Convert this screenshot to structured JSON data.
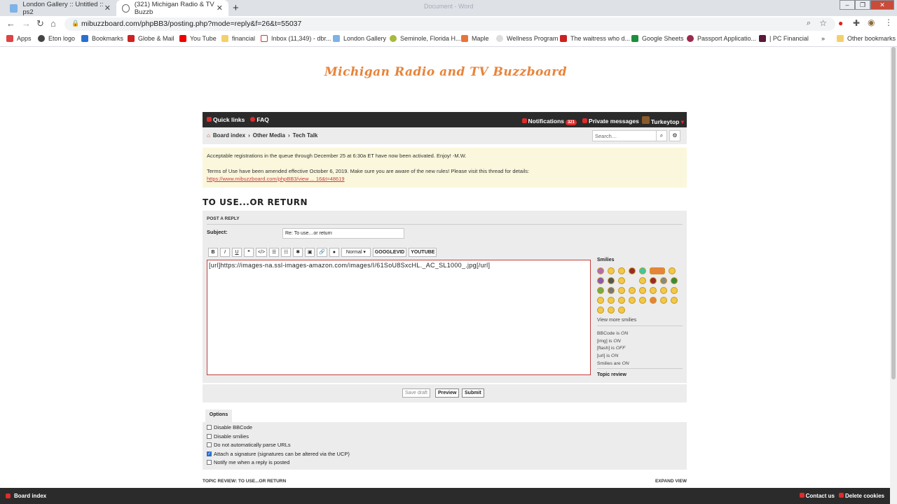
{
  "browser": {
    "tabs": [
      {
        "title": "London Gallery :: Untitled :: ps2"
      },
      {
        "title": "(321) Michigan Radio & TV Buzzb"
      }
    ],
    "window_title": "Document - Word",
    "url": "mibuzzboard.com/phpBB3/posting.php?mode=reply&f=26&t=55037",
    "bookmarks": [
      "Apps",
      "Eton logo",
      "Bookmarks",
      "Globe & Mail",
      "You Tube",
      "financial",
      "Inbox (11,349) - dbr...",
      "London Gallery",
      "Seminole, Florida H...",
      "Maple",
      "Wellness Program",
      "The waitress who d...",
      "Google Sheets",
      "Passport Applicatio...",
      "| PC Financial",
      "»",
      "Other bookmarks"
    ]
  },
  "site": {
    "logo": "Michigan Radio and TV Buzzboard",
    "nav": {
      "quick_links": "Quick links",
      "faq": "FAQ",
      "notifications": "Notifications",
      "notifications_count": "321",
      "private_messages": "Private messages",
      "username": "Turkeytop"
    },
    "breadcrumb": [
      "Board index",
      "Other Media",
      "Tech Talk"
    ],
    "search_placeholder": "Search…",
    "notice_line1": "Acceptable registrations in the queue through December 25 at 6:30a ET have now been activated. Enjoy! -M.W.",
    "notice_line2": "Terms of Use have been amended effective October 6, 2019. Make sure you are aware of the new rules! Please visit this thread for details:",
    "notice_link": "https://www.mibuzzboard.com/phpBB3/view ... 16&t=48619",
    "topic_title": "TO USE...OR RETURN"
  },
  "post": {
    "header": "POST A REPLY",
    "subject_label": "Subject:",
    "subject_value": "Re: To use…or return",
    "toolbar": [
      "B",
      "I",
      "U",
      "❝",
      "</>",
      "☰",
      "☷",
      "✱",
      "▣",
      "🔗",
      "●"
    ],
    "font_size": "Normal",
    "googlevid": "GOOGLEVID",
    "youtube": "YOUTUBE",
    "message": "[url]https://images-na.ssl-images-amazon.com/images/I/61SoU8SxcHL._AC_SL1000_.jpg[/url]",
    "smilies_label": "Smilies",
    "view_more": "View more smilies",
    "status": [
      {
        "label": "BBCode is ",
        "value": "ON"
      },
      {
        "label": "[img] is ",
        "value": "ON"
      },
      {
        "label": "[flash] is ",
        "value": "OFF"
      },
      {
        "label": "[url] is ",
        "value": "ON"
      },
      {
        "label": "Smilies are ",
        "value": "ON"
      }
    ],
    "topic_review": "Topic review",
    "save_draft": "Save draft",
    "preview": "Preview",
    "submit": "Submit"
  },
  "options": {
    "tab": "Options",
    "items": [
      {
        "label": "Disable BBCode",
        "checked": false
      },
      {
        "label": "Disable smilies",
        "checked": false
      },
      {
        "label": "Do not automatically parse URLs",
        "checked": false
      },
      {
        "label": "Attach a signature (signatures can be altered via the UCP)",
        "checked": true
      },
      {
        "label": "Notify me when a reply is posted",
        "checked": false
      }
    ]
  },
  "topic_review_bar": {
    "title": "TOPIC REVIEW: TO USE...OR RETURN",
    "expand": "EXPAND VIEW"
  },
  "footer": {
    "board_index": "Board index",
    "contact": "Contact us",
    "delete_cookies": "Delete cookies"
  }
}
